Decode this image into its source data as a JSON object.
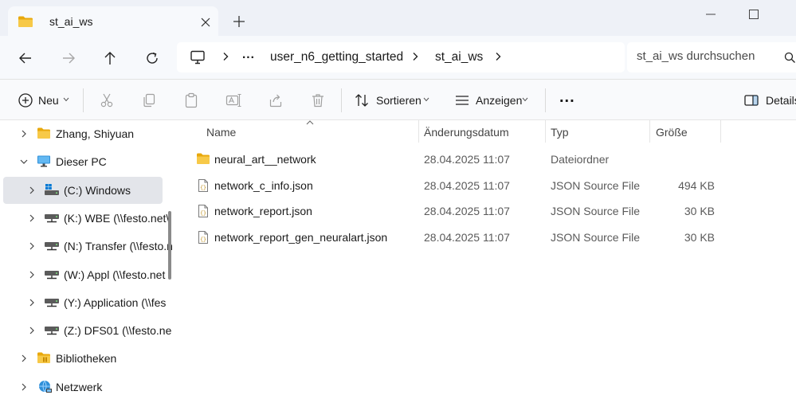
{
  "window": {
    "tab_title": "st_ai_ws",
    "icons": {
      "tab": "folder-icon",
      "close": "close-icon",
      "new_tab": "plus-icon",
      "minimize": "minimize-icon",
      "maximize": "maximize-icon"
    }
  },
  "nav": {
    "icons": [
      "back-arrow-icon",
      "forward-arrow-icon",
      "up-arrow-icon",
      "refresh-icon"
    ],
    "breadcrumb": {
      "root_icon": "computer-icon",
      "items": [
        "...",
        "user_n6_getting_started",
        "st_ai_ws"
      ]
    },
    "search_placeholder": "st_ai_ws durchsuchen"
  },
  "toolbar": {
    "new_label": "Neu",
    "sort_label": "Sortieren",
    "view_label": "Anzeigen",
    "more_label": "...",
    "details_label": "Details",
    "icons": [
      "new-plus-icon",
      "cut-icon",
      "copy-icon",
      "paste-icon",
      "rename-icon",
      "share-icon",
      "delete-icon",
      "sort-icon",
      "view-icon",
      "more-icon",
      "details-pane-icon"
    ]
  },
  "sidebar": {
    "items": [
      {
        "label": "Zhang, Shiyuan",
        "icon": "folder-icon",
        "expanded": false,
        "selected": false
      },
      {
        "label": "Dieser PC",
        "icon": "pc-icon",
        "expanded": true,
        "selected": false
      },
      {
        "label": "(C:) Windows",
        "icon": "windows-drive-icon",
        "expanded": false,
        "selected": true
      },
      {
        "label": "(K:) WBE (\\\\festo.net\\",
        "icon": "network-drive-icon",
        "expanded": false,
        "selected": false
      },
      {
        "label": "(N:) Transfer (\\\\festo.n",
        "icon": "network-drive-icon",
        "expanded": false,
        "selected": false
      },
      {
        "label": "(W:) Appl (\\\\festo.net",
        "icon": "network-drive-icon",
        "expanded": false,
        "selected": false
      },
      {
        "label": "(Y:) Application (\\\\fes",
        "icon": "network-drive-icon",
        "expanded": false,
        "selected": false
      },
      {
        "label": "(Z:) DFS01 (\\\\festo.ne",
        "icon": "network-drive-icon",
        "expanded": false,
        "selected": false
      },
      {
        "label": "Bibliotheken",
        "icon": "library-folder-icon",
        "expanded": false,
        "selected": false
      },
      {
        "label": "Netzwerk",
        "icon": "network-icon",
        "expanded": false,
        "selected": false
      }
    ]
  },
  "content": {
    "columns": {
      "name": "Name",
      "date": "Änderungsdatum",
      "type": "Typ",
      "size": "Größe"
    },
    "rows": [
      {
        "name": "neural_art__network",
        "date": "28.04.2025 11:07",
        "type": "Dateiordner",
        "size": "",
        "icon": "folder-icon"
      },
      {
        "name": "network_c_info.json",
        "date": "28.04.2025 11:07",
        "type": "JSON Source File",
        "size": "494 KB",
        "icon": "json-file-icon"
      },
      {
        "name": "network_report.json",
        "date": "28.04.2025 11:07",
        "type": "JSON Source File",
        "size": "30 KB",
        "icon": "json-file-icon"
      },
      {
        "name": "network_report_gen_neuralart.json",
        "date": "28.04.2025 11:07",
        "type": "JSON Source File",
        "size": "30 KB",
        "icon": "json-file-icon"
      }
    ]
  },
  "colors": {
    "folder": "#f5c242",
    "accent": "#0067c0",
    "selected_row": "#e3e5ea",
    "titlebar": "#eef1f7"
  }
}
